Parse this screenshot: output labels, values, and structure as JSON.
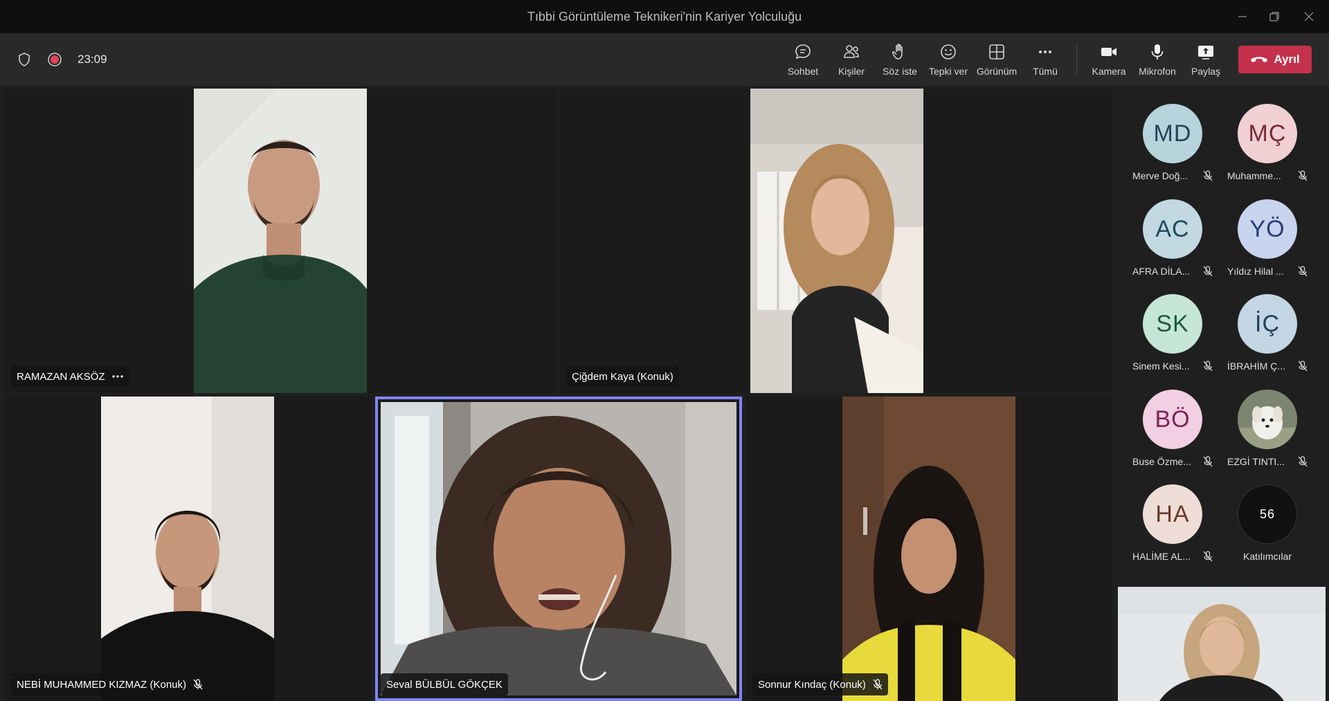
{
  "window": {
    "title": "Tıbbi Görüntüleme Teknikeri'nin Kariyer Yolculuğu"
  },
  "toolbar": {
    "timer": "23:09",
    "buttons": {
      "chat": "Sohbet",
      "people": "Kişiler",
      "raise_hand": "Söz iste",
      "react": "Tepki ver",
      "view": "Görünüm",
      "more": "Tümü",
      "camera": "Kamera",
      "mic": "Mikrofon",
      "share": "Paylaş"
    },
    "leave_label": "Ayrıl"
  },
  "participants_video": [
    {
      "name": "RAMAZAN AKSÖZ"
    },
    {
      "name": "Çiğdem Kaya (Konuk)"
    },
    {
      "name": "NEBİ MUHAMMED KIZMAZ (Konuk)"
    },
    {
      "name": "Seval BÜLBÜL GÖKÇEK"
    },
    {
      "name": "Sonnur Kındaç (Konuk)"
    }
  ],
  "sidebar": {
    "people": [
      {
        "initials": "MD",
        "name": "Merve Doğ...",
        "bg": "#b7d3dc",
        "fg": "#23445a"
      },
      {
        "initials": "MÇ",
        "name": "Muhamme...",
        "bg": "#f1d0d3",
        "fg": "#7a2b36"
      },
      {
        "initials": "AC",
        "name": "AFRA DİLA...",
        "bg": "#c2d9e2",
        "fg": "#1e4a5c"
      },
      {
        "initials": "YÖ",
        "name": "Yıldız Hilal ...",
        "bg": "#c8d3ee",
        "fg": "#283c72"
      },
      {
        "initials": "SK",
        "name": "Sinem Kesi...",
        "bg": "#c6e6d7",
        "fg": "#1d5a3d"
      },
      {
        "initials": "İÇ",
        "name": "İBRAHİM Ç...",
        "bg": "#c3d6e4",
        "fg": "#1f4058"
      },
      {
        "initials": "BÖ",
        "name": "Buse Özme...",
        "bg": "#f2cfe3",
        "fg": "#7b2457"
      },
      {
        "initials": "",
        "name": "EZGİ TINTI...",
        "bg": "#8a8f7a",
        "fg": "#ffffff"
      },
      {
        "initials": "HA",
        "name": "HALİME AL...",
        "bg": "#eeddd6",
        "fg": "#6a3a2a"
      }
    ],
    "overflow_count": "56",
    "overflow_label": "Katılımcılar"
  }
}
